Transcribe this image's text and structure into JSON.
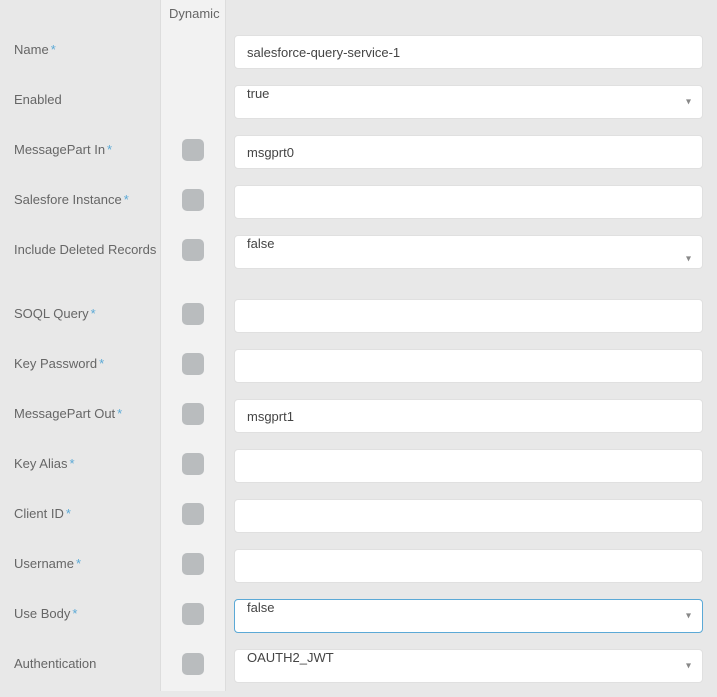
{
  "header": {
    "dynamic": "Dynamic"
  },
  "fields": {
    "name": {
      "label": "Name",
      "required": true,
      "value": "salesforce-query-service-1"
    },
    "enabled": {
      "label": "Enabled",
      "required": false,
      "value": "true"
    },
    "msgIn": {
      "label": "MessagePart In",
      "required": true,
      "value": "msgprt0"
    },
    "sfInstance": {
      "label": "Salesfore Instance",
      "required": true,
      "value": ""
    },
    "includeDeleted": {
      "label": "Include Deleted Records",
      "required": false,
      "value": "false"
    },
    "soql": {
      "label": "SOQL Query",
      "required": true,
      "value": ""
    },
    "keyPassword": {
      "label": "Key Password",
      "required": true,
      "value": ""
    },
    "msgOut": {
      "label": "MessagePart Out",
      "required": true,
      "value": "msgprt1"
    },
    "keyAlias": {
      "label": "Key Alias",
      "required": true,
      "value": ""
    },
    "clientId": {
      "label": "Client ID",
      "required": true,
      "value": ""
    },
    "username": {
      "label": "Username",
      "required": true,
      "value": ""
    },
    "useBody": {
      "label": "Use Body",
      "required": true,
      "value": "false"
    },
    "auth": {
      "label": "Authentication",
      "required": false,
      "value": "OAUTH2_JWT"
    }
  },
  "requiredMark": "*"
}
